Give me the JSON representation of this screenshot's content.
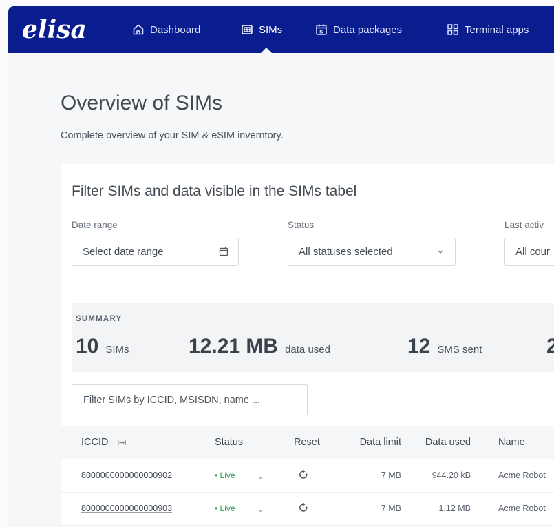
{
  "brand": {
    "logo_text": "elisa",
    "nav_bg": "#0a1d8f",
    "status_live_color": "#2e9b52"
  },
  "nav": {
    "items": [
      {
        "label": "Dashboard",
        "icon": "home-icon"
      },
      {
        "label": "SIMs",
        "icon": "sim-card-icon",
        "active": true
      },
      {
        "label": "Data packages",
        "icon": "data-package-icon"
      },
      {
        "label": "Terminal apps",
        "icon": "grid-apps-icon"
      }
    ]
  },
  "page": {
    "title": "Overview of SIMs",
    "subtitle": "Complete overview of your SIM & eSIM inverntory."
  },
  "filters": {
    "title": "Filter SIMs and data visible in the SIMs tabel",
    "date_range": {
      "label": "Date range",
      "value": "Select date range",
      "icon": "calendar-icon"
    },
    "status": {
      "label": "Status",
      "value": "All statuses selected",
      "icon": "chevron-down-icon"
    },
    "last_active": {
      "label": "Last activ",
      "value": "All cour"
    }
  },
  "summary": {
    "label": "SUMMARY",
    "sims": {
      "value": "10",
      "label": "SIMs"
    },
    "data": {
      "value": "12.21 MB",
      "label": "data used"
    },
    "sms": {
      "value": "12",
      "label": "SMS sent"
    },
    "partial": {
      "value": "2"
    }
  },
  "search": {
    "placeholder": "Filter SIMs by ICCID, MSISDN, name ..."
  },
  "table": {
    "columns": [
      "ICCID",
      "Status",
      "Reset",
      "Data limit",
      "Data used",
      "Name"
    ],
    "sort_icon": "column-resize-icon",
    "rows": [
      {
        "iccid": "8000000000000000902",
        "status": "• Live",
        "data_limit": "7 MB",
        "data_used": "944.20 kB",
        "name": "Acme Robot"
      },
      {
        "iccid": "8000000000000000903",
        "status": "• Live",
        "data_limit": "7 MB",
        "data_used": "1.12 MB",
        "name": "Acme Robot"
      }
    ]
  }
}
